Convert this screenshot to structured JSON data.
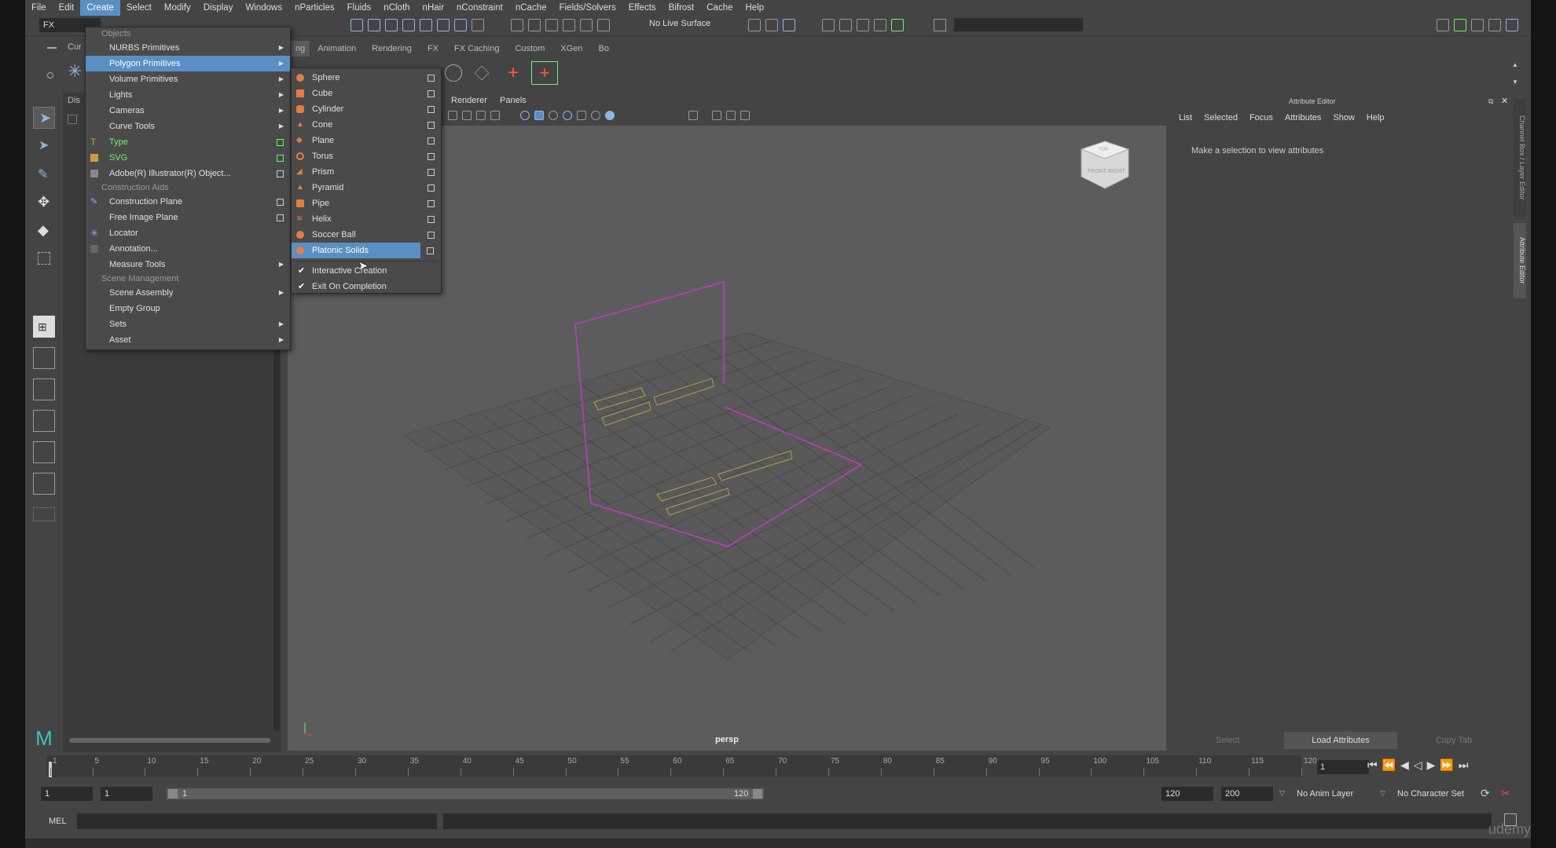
{
  "menubar": {
    "items": [
      "File",
      "Edit",
      "Create",
      "Select",
      "Modify",
      "Display",
      "Windows",
      "nParticles",
      "Fluids",
      "nCloth",
      "nHair",
      "nConstraint",
      "nCache",
      "Fields/Solvers",
      "Effects",
      "Bifrost",
      "Cache",
      "Help"
    ],
    "active": "Create"
  },
  "status_line": {
    "mode": "FX",
    "live_surface": "No Live Surface"
  },
  "shelf": {
    "tabs": [
      "ng",
      "Animation",
      "Rendering",
      "FX",
      "FX Caching",
      "Custom",
      "XGen",
      "Bo"
    ]
  },
  "outliner": {
    "header_a": "Cur",
    "header_b": "Dis"
  },
  "create_menu": {
    "sections": {
      "objects": "Objects",
      "construction_aids": "Construction Aids",
      "scene_management": "Scene Management"
    },
    "items": {
      "nurbs": "NURBS Primitives",
      "polygon": "Polygon Primitives",
      "volume": "Volume Primitives",
      "lights": "Lights",
      "cameras": "Cameras",
      "curve_tools": "Curve Tools",
      "type": "Type",
      "svg": "SVG",
      "illustrator": "Adobe(R) Illustrator(R) Object...",
      "construction_plane": "Construction Plane",
      "free_image_plane": "Free Image Plane",
      "locator": "Locator",
      "annotation": "Annotation...",
      "measure_tools": "Measure Tools",
      "scene_assembly": "Scene Assembly",
      "empty_group": "Empty Group",
      "sets": "Sets",
      "asset": "Asset"
    }
  },
  "poly_menu": {
    "items": [
      "Sphere",
      "Cube",
      "Cylinder",
      "Cone",
      "Plane",
      "Torus",
      "Prism",
      "Pyramid",
      "Pipe",
      "Helix",
      "Soccer Ball",
      "Platonic Solids"
    ],
    "highlighted": "Platonic Solids",
    "interactive_creation": "Interactive Creation",
    "exit_on_completion": "Exit On Completion"
  },
  "viewport": {
    "menu": [
      "Renderer",
      "Panels"
    ],
    "camera_label": "persp",
    "viewcube_faces": [
      "FRONT",
      "RIGHT",
      "TOP"
    ]
  },
  "attribute_editor": {
    "title": "Attribute Editor",
    "menu": [
      "List",
      "Selected",
      "Focus",
      "Attributes",
      "Show",
      "Help"
    ],
    "message": "Make a selection to view attributes",
    "buttons": {
      "select": "Select",
      "load": "Load Attributes",
      "copy_tab": "Copy Tab"
    },
    "side_tabs": [
      "Channel Box / Layer Editor",
      "Attribute Editor"
    ]
  },
  "time_slider": {
    "ticks": [
      "1",
      "5",
      "10",
      "15",
      "20",
      "25",
      "30",
      "35",
      "40",
      "45",
      "50",
      "55",
      "60",
      "65",
      "70",
      "75",
      "80",
      "85",
      "90",
      "95",
      "100",
      "105",
      "110",
      "115",
      "120"
    ],
    "current_frame": "1"
  },
  "range_slider": {
    "start": "1",
    "playback_start": "1",
    "bar_start": "1",
    "bar_end": "120",
    "playback_end": "120",
    "end": "200",
    "anim_layer": "No Anim Layer",
    "character_set": "No Character Set"
  },
  "command_line": {
    "label": "MEL"
  },
  "watermark": "udemy",
  "colors": {
    "highlight": "#5a8fc4",
    "grid_plane": "#c03cc0",
    "type_text": "#c8b04a",
    "green_label": "#6ef06e"
  }
}
